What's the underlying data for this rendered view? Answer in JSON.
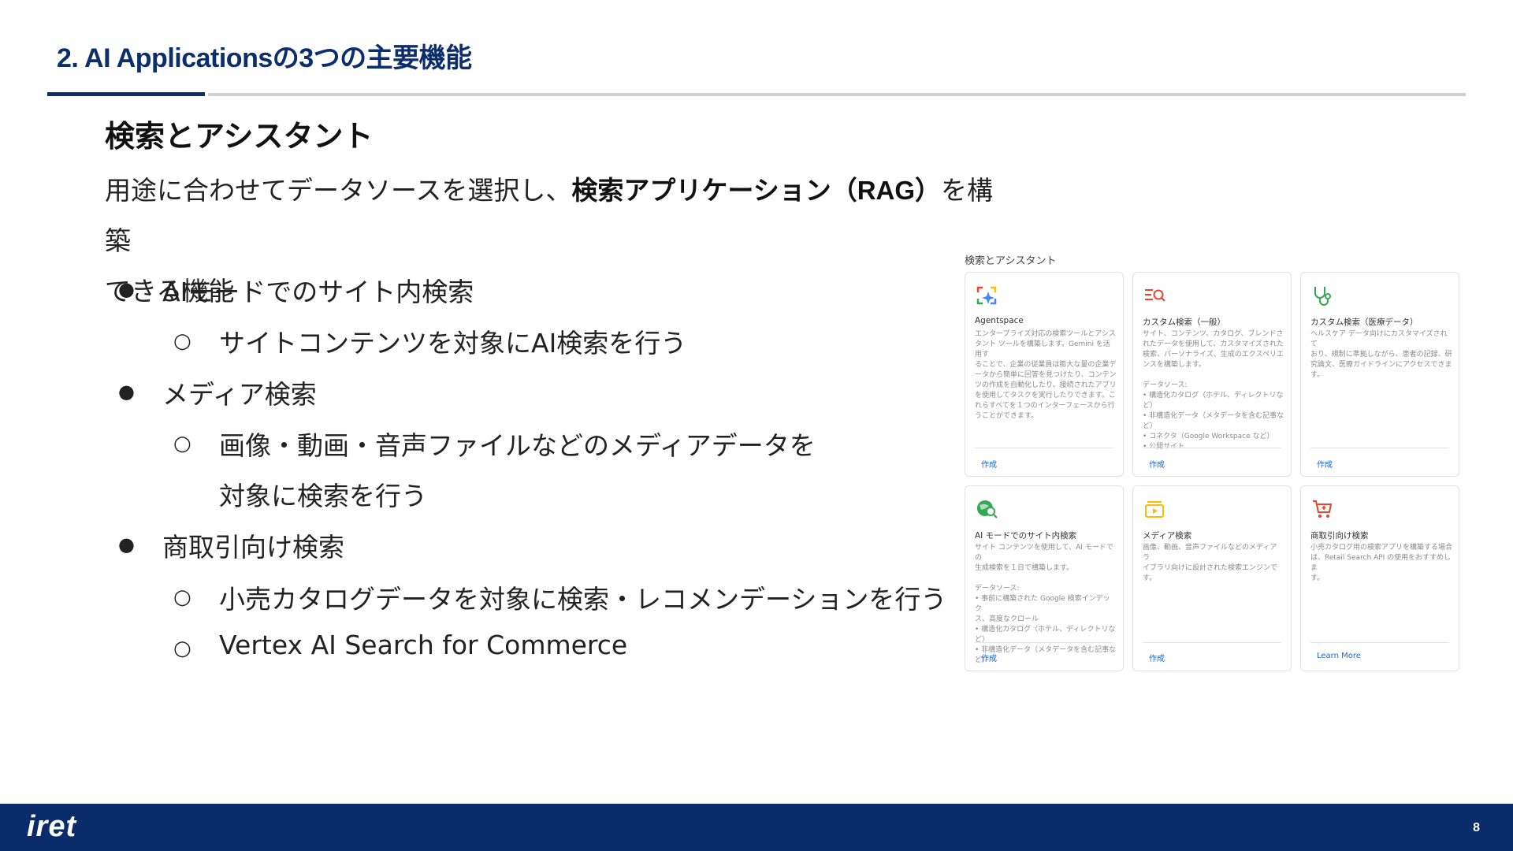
{
  "header": {
    "title": "2. AI Applicationsの3つの主要機能"
  },
  "section": {
    "heading": "検索とアシスタント",
    "intro_pre": "用途に合わせてデータソースを選択し、",
    "intro_bold": "検索アプリケーション（RAG）",
    "intro_post": "を構築",
    "intro_line2": "できる機能"
  },
  "bullets": [
    {
      "text": "AIモードでのサイト内検索",
      "sub": [
        "サイトコンテンツを対象にAI検索を行う"
      ]
    },
    {
      "text": "メディア検索",
      "sub": [
        "画像・動画・音声ファイルなどのメディアデータを",
        "対象に検索を行う"
      ]
    },
    {
      "text": "商取引向け検索",
      "sub": [
        "小売カタログデータを対象に検索・レコメンデーションを行う",
        "Vertex AI Search for Commerce"
      ]
    }
  ],
  "markers": {
    "level1": "●",
    "level2": "○"
  },
  "panel": {
    "caption": "検索とアシスタント",
    "cards": [
      {
        "title": "Agentspace",
        "icon": "agentspace-icon",
        "desc": "エンタープライズ対応の検索ツールとアシス\nタント ツールを構築します。Gemini を活用す\nることで、企業の従業員は膨大な量の企業デ\nータから簡単に回答を見つけたり、コンテン\nツの作成を自動化したり、接続されたアプリ\nを使用してタスクを実行したりできます。こ\nれらすべてを１つのインターフェースから行\nうことができます。",
        "link": "作成"
      },
      {
        "title": "カスタム検索（一般）",
        "icon": "custom-search-icon",
        "desc": "サイト、コンテンツ、カタログ、ブレンドさ\nれたデータを使用して、カスタマイズされた\n検索、パーソナライズ、生成のエクスペリエ\nンスを構築します。\n\nデータソース:\n• 構造化カタログ（ホテル、ディレクトリな\nど）\n• 非構造化データ（メタデータを含む記事な\nど）\n• コネクタ（Google Workspace など）\n• 公開サイト",
        "link": "作成"
      },
      {
        "title": "カスタム検索（医療データ）",
        "icon": "stethoscope-icon",
        "desc": "ヘルスケア データ向けにカスタマイズされて\nおり、規制に準拠しながら、患者の記録、研\n究論文、医療ガイドラインにアクセスできま\nす。",
        "link": "作成"
      },
      {
        "title": "AI モードでのサイト内検索",
        "icon": "site-search-icon",
        "desc": "サイト コンテンツを使用して、AI モードでの\n生成検索を１日で構築します。\n\nデータソース:\n• 事前に構築された Google 検索インデック\nス、高度なクロール\n• 構造化カタログ（ホテル、ディレクトリな\nど）\n• 非構造化データ（メタデータを含む記事な\nど）",
        "link": "作成"
      },
      {
        "title": "メディア検索",
        "icon": "media-icon",
        "desc": "画像、動画、音声ファイルなどのメディア ラ\nイブラリ向けに設計された検索エンジンで\nす。",
        "link": "作成"
      },
      {
        "title": "商取引向け検索",
        "icon": "cart-icon",
        "desc": "小売カタログ用の検索アプリを構築する場合\nは、Retail Search API の使用をおすすめしま\nす。",
        "link": "Learn More"
      }
    ]
  },
  "footer": {
    "logo": "iret",
    "page": "8"
  },
  "colors": {
    "brand": "#0b2c6b",
    "link": "#1a66d2"
  }
}
